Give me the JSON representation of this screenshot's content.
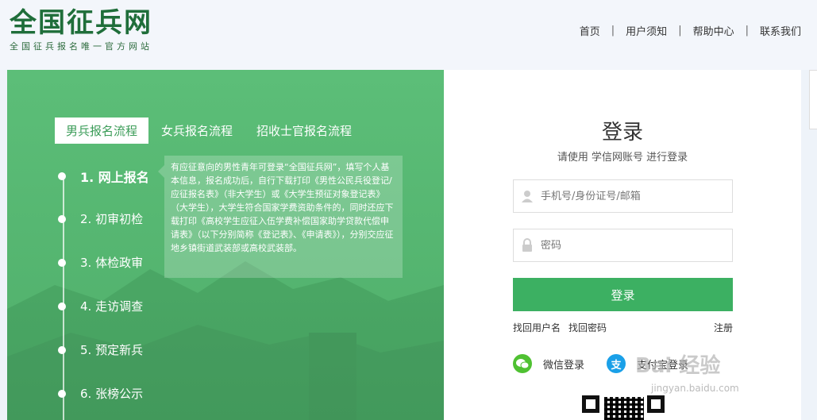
{
  "header": {
    "logo_title": "全国征兵网",
    "logo_subtitle": "全国征兵报名唯一官方网站",
    "nav": [
      "首页",
      "用户须知",
      "帮助中心",
      "联系我们"
    ]
  },
  "process": {
    "tabs": [
      "男兵报名流程",
      "女兵报名流程",
      "招收士官报名流程"
    ],
    "active_tab": 0,
    "steps": [
      "1. 网上报名",
      "2. 初审初检",
      "3. 体检政审",
      "4. 走访调查",
      "5. 预定新兵",
      "6. 张榜公示"
    ],
    "active_step": 0,
    "description": "有应征意向的男性青年可登录“全国征兵网”，填写个人基本信息，报名成功后，自行下载打印《男性公民兵役登记/应征报名表》（非大学生）或《大学生预征对象登记表》（大学生），大学生符合国家学费资助条件的，同时还应下载打印《高校学生应征入伍学费补偿国家助学贷款代偿申请表》（以下分别简称《登记表》、《申请表》），分别交应征 地乡镇街道武装部或高校武装部。"
  },
  "login": {
    "title": "登录",
    "subtitle": "请使用 学信网账号 进行登录",
    "username_placeholder": "手机号/身份证号/邮箱",
    "password_placeholder": "密码",
    "submit_label": "登录",
    "forgot_username": "找回用户名",
    "forgot_password": "找回密码",
    "register": "注册",
    "wechat_label": "微信登录",
    "alipay_label": "支付宝登录",
    "alipay_icon_text": "支"
  },
  "watermark": {
    "text": "Bai 经验",
    "url": "jingyan.baidu.com"
  },
  "colors": {
    "brand_green": "#1f6e3a",
    "panel_green": "#55b570",
    "button_green": "#3cb062",
    "wechat_green": "#4fc132",
    "alipay_blue": "#1aa0e8"
  }
}
